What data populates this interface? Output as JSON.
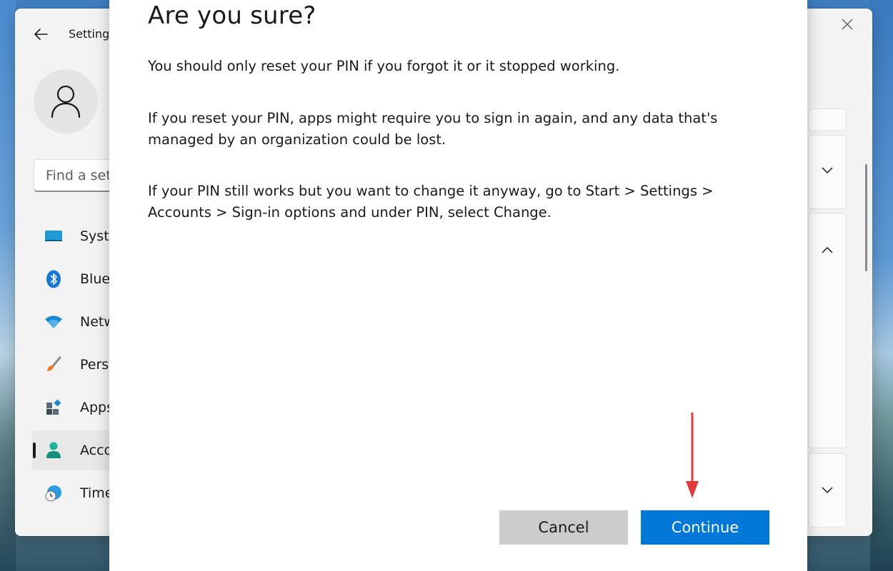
{
  "window": {
    "title": "Setting"
  },
  "search": {
    "placeholder": "Find a set"
  },
  "nav": {
    "items": [
      {
        "label": "Syste",
        "icon": "system-icon"
      },
      {
        "label": "Blue",
        "icon": "bluetooth-icon"
      },
      {
        "label": "Netw",
        "icon": "wifi-icon"
      },
      {
        "label": "Perso",
        "icon": "paintbrush-icon"
      },
      {
        "label": "Apps",
        "icon": "apps-icon"
      },
      {
        "label": "Acco",
        "icon": "accounts-icon",
        "active": true
      },
      {
        "label": "Time",
        "icon": "time-language-icon"
      }
    ]
  },
  "dialog": {
    "title": "Are you sure?",
    "paragraphs": [
      "You should only reset your PIN if you forgot it or it stopped working.",
      "If you reset your PIN, apps might require you to sign in again, and any data that's managed by an organization could be lost.",
      "If your PIN still works but you want to change it anyway, go to Start > Settings > Accounts > Sign-in options and under PIN, select Change."
    ],
    "cancel_label": "Cancel",
    "continue_label": "Continue"
  },
  "colors": {
    "accent": "#0078d7",
    "annotation_arrow": "#e03c3c",
    "cancel_bg": "#cccccc"
  }
}
